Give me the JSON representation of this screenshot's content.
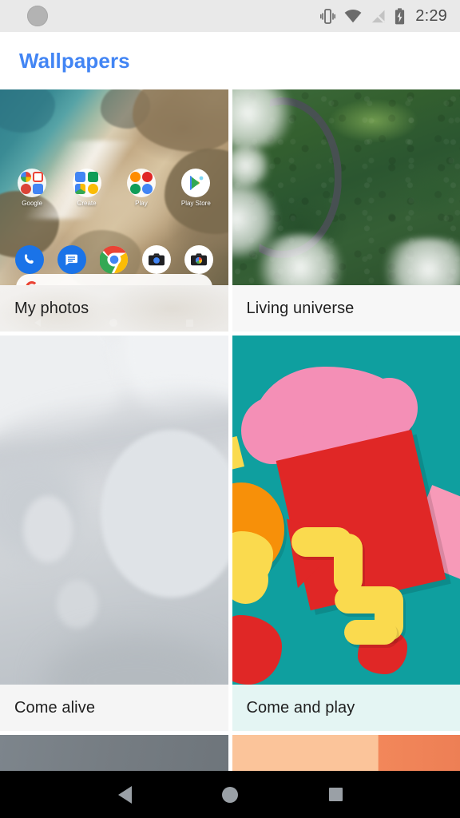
{
  "status_bar": {
    "time": "2:29",
    "icons": [
      "notification-dot",
      "vibrate-icon",
      "wifi-icon",
      "no-signal-icon",
      "battery-charging-icon"
    ],
    "background": "#e9e9e9"
  },
  "app_bar": {
    "title": "Wallpapers",
    "title_color": "#4285f4"
  },
  "grid": {
    "rows": [
      {
        "tiles": [
          {
            "label": "My photos",
            "type": "home-screen-preview",
            "label_bg": "#f1efed",
            "home_preview": {
              "folders": [
                {
                  "name": "Google",
                  "apps": [
                    "google-icon",
                    "gmail-icon",
                    "google-plus-icon",
                    "news-icon"
                  ]
                },
                {
                  "name": "Create",
                  "apps": [
                    "docs-icon",
                    "sheets-icon",
                    "drive-icon",
                    "keep-icon"
                  ]
                },
                {
                  "name": "Play",
                  "apps": [
                    "play-music-icon",
                    "play-movies-icon",
                    "play-games-icon",
                    "play-books-icon"
                  ]
                },
                {
                  "name": "Play Store",
                  "apps": [
                    "play-store-icon"
                  ]
                }
              ],
              "dock": [
                "phone-icon",
                "messages-icon",
                "chrome-icon",
                "camera-icon",
                "photos-camera-icon"
              ],
              "search_bar": "google-search-pill"
            }
          },
          {
            "label": "Living universe",
            "type": "photo",
            "label_bg": "#f7f7f7",
            "description": "aerial forest with winding road and clouds"
          }
        ]
      },
      {
        "tiles": [
          {
            "label": "Come alive",
            "type": "abstract",
            "label_bg": "#f5f5f5",
            "description": "soft grey blobs and circles"
          },
          {
            "label": "Come and play",
            "type": "abstract",
            "label_bg": "#e4f5f3",
            "accent": "#0f9f9f",
            "description": "paper-cut shapes on teal"
          }
        ]
      },
      {
        "partial": true,
        "tiles": [
          {
            "label": "",
            "type": "partial",
            "color": "#767d83"
          },
          {
            "label": "",
            "type": "partial",
            "color": "#fbc49a"
          }
        ]
      }
    ]
  },
  "nav_bar": {
    "background": "#000000",
    "buttons": [
      "back-button",
      "home-button",
      "recents-button"
    ]
  }
}
